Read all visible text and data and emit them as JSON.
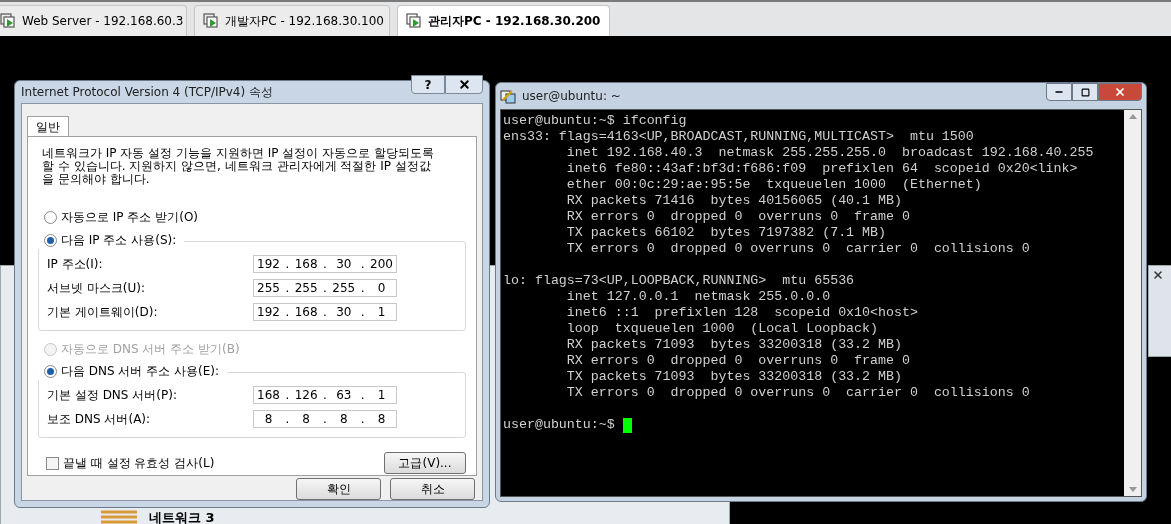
{
  "tabs": [
    {
      "label": "Web Server - 192.168.60.3",
      "selected": false
    },
    {
      "label": "개발자PC - 192.168.30.100",
      "selected": false
    },
    {
      "label": "관리자PC - 192.168.30.200",
      "selected": true
    }
  ],
  "dialog": {
    "title": "Internet Protocol Version 4 (TCP/IPv4) 속성",
    "help_button": "?",
    "tab": "일반",
    "description": "네트워크가 IP 자동 설정 기능을 지원하면 IP 설정이 자동으로 할당되도록 할 수 있습니다. 지원하지 않으면, 네트워크 관리자에게 적절한 IP 설정값을 문의해야 합니다.",
    "separator": ".",
    "ip_options": [
      {
        "label": "자동으로 IP 주소 받기(O)",
        "selected": false,
        "disabled": false
      },
      {
        "label": "다음 IP 주소 사용(S):",
        "selected": true,
        "disabled": false
      }
    ],
    "ip_fields": [
      {
        "label": "IP 주소(I):",
        "octets": [
          "192",
          "168",
          "30",
          "200"
        ]
      },
      {
        "label": "서브넷 마스크(U):",
        "octets": [
          "255",
          "255",
          "255",
          "0"
        ]
      },
      {
        "label": "기본 게이트웨이(D):",
        "octets": [
          "192",
          "168",
          "30",
          "1"
        ]
      }
    ],
    "dns_options": [
      {
        "label": "자동으로 DNS 서버 주소 받기(B)",
        "selected": false,
        "disabled": true
      },
      {
        "label": "다음 DNS 서버 주소 사용(E):",
        "selected": true,
        "disabled": false
      }
    ],
    "dns_fields": [
      {
        "label": "기본 설정 DNS 서버(P):",
        "octets": [
          "168",
          "126",
          "63",
          "1"
        ]
      },
      {
        "label": "보조 DNS 서버(A):",
        "octets": [
          "8",
          "8",
          "8",
          "8"
        ]
      }
    ],
    "validate": {
      "label": "끝낼 때 설정 유효성 검사(L)",
      "checked": false
    },
    "advanced_button": "고급(V)...",
    "buttons": [
      "확인",
      "취소"
    ]
  },
  "terminal": {
    "title": "user@ubuntu: ~",
    "sections": [
      [
        "user@ubuntu:~$ ifconfig",
        "ens33: flags=4163<UP,BROADCAST,RUNNING,MULTICAST>  mtu 1500",
        "        inet 192.168.40.3  netmask 255.255.255.0  broadcast 192.168.40.255",
        "        inet6 fe80::43af:bf3d:f686:f09  prefixlen 64  scopeid 0x20<link>",
        "        ether 00:0c:29:ae:95:5e  txqueuelen 1000  (Ethernet)",
        "        RX packets 71416  bytes 40156065 (40.1 MB)",
        "        RX errors 0  dropped 0  overruns 0  frame 0",
        "        TX packets 66102  bytes 7197382 (7.1 MB)",
        "        TX errors 0  dropped 0 overruns 0  carrier 0  collisions 0"
      ],
      [
        "lo: flags=73<UP,LOOPBACK,RUNNING>  mtu 65536",
        "        inet 127.0.0.1  netmask 255.0.0.0",
        "        inet6 ::1  prefixlen 128  scopeid 0x10<host>",
        "        loop  txqueuelen 1000  (Local Loopback)",
        "        RX packets 71093  bytes 33200318 (33.2 MB)",
        "        RX errors 0  dropped 0  overruns 0  frame 0",
        "        TX packets 71093  bytes 33200318 (33.2 MB)",
        "        TX errors 0  dropped 0 overruns 0  carrier 0  collisions 0"
      ]
    ],
    "prompt": "user@ubuntu:~$"
  },
  "desktop": {
    "item": "네트워크 3"
  }
}
